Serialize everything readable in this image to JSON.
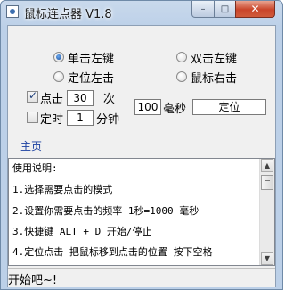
{
  "window": {
    "title": "鼠标连点器 V1.8"
  },
  "controls": {
    "minimize": "–",
    "maximize": "□",
    "close": "✕"
  },
  "mode": {
    "options": [
      {
        "label": "单击左键",
        "checked": true
      },
      {
        "label": "双击左键",
        "checked": false
      },
      {
        "label": "定位左击",
        "checked": false
      },
      {
        "label": "鼠标右击",
        "checked": false
      }
    ]
  },
  "click_count": {
    "label": "点击",
    "value": "30",
    "unit": "次",
    "checked": true
  },
  "timer": {
    "label": "定时",
    "value": "1",
    "unit": "分钟",
    "checked": false
  },
  "interval": {
    "value": "100",
    "unit": "毫秒"
  },
  "locate_field": {
    "value": "定位"
  },
  "home_link": "主页",
  "instructions": [
    "使用说明:",
    "1.选择需要点击的模式",
    "2.设置你需要点击的频率 1秒=1000 毫秒",
    "3.快捷键 ALT + D 开始/停止",
    "4.定位点击 把鼠标移到点击的位置 按下空格"
  ],
  "status": "开始吧~!"
}
